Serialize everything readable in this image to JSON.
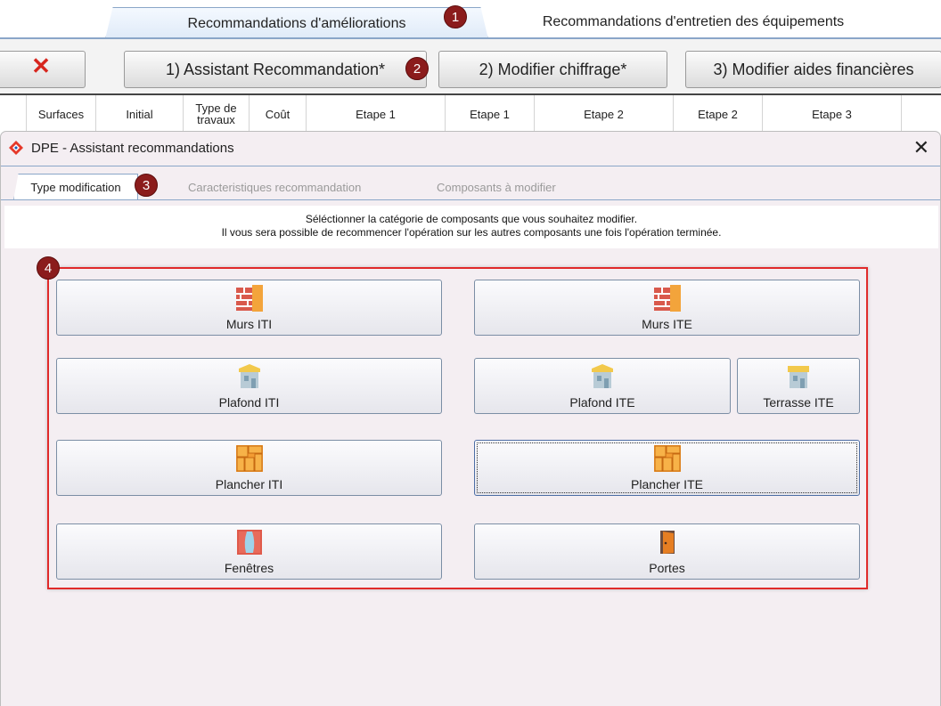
{
  "top_tabs": {
    "tab1": "Recommandations d'améliorations",
    "tab2": "Recommandations d'entretien des équipements"
  },
  "toolbar": {
    "close_icon": "red-x-icon",
    "assistant": "1) Assistant Recommandation*",
    "chiffrage": "2) Modifier chiffrage*",
    "aides": "3) Modifier aides financières"
  },
  "grid_header": {
    "columns": [
      "Surfaces",
      "Initial",
      "Type de travaux",
      "Coût",
      "Etape 1",
      "Etape 1",
      "Etape 2",
      "Etape 2",
      "Etape 3"
    ]
  },
  "dialog": {
    "title": "DPE - Assistant recommandations",
    "close": "✕",
    "tabs": [
      "Type modification",
      "Caracteristiques recommandation",
      "Composants à modifier"
    ],
    "instruction_line1": "Séléctionner la catégorie de composants que vous souhaitez modifier.",
    "instruction_line2": "Il vous sera possible de recommencer l'opération sur les autres composants une fois l'opération terminée."
  },
  "components": {
    "murs_iti": "Murs ITI",
    "murs_ite": "Murs ITE",
    "plafond_iti": "Plafond ITI",
    "plafond_ite": "Plafond ITE",
    "terrasse_ite": "Terrasse ITE",
    "plancher_iti": "Plancher ITI",
    "plancher_ite": "Plancher ITE",
    "fenetres": "Fenêtres",
    "portes": "Portes"
  },
  "badges": [
    "1",
    "2",
    "3",
    "4"
  ],
  "colors": {
    "badge": "#8b1c1c",
    "highlight_box": "#e02a2a",
    "tab_border": "#8aa6c8"
  }
}
